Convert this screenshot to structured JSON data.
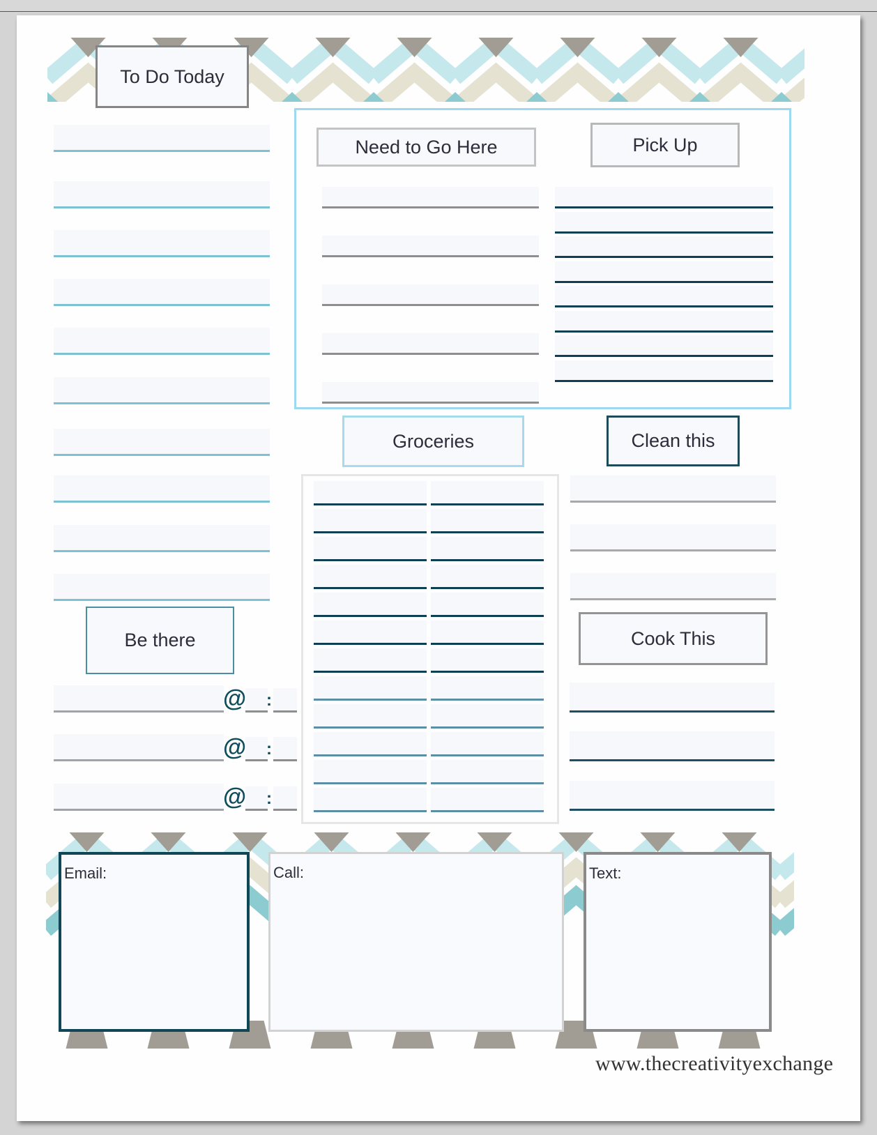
{
  "document": {
    "site_url": "www.thecreativityexchange"
  },
  "sections": {
    "to_do_today": {
      "title": "To Do Today",
      "line_count": 10
    },
    "need_to_go_here": {
      "title": "Need to Go Here",
      "line_count": 5
    },
    "pick_up": {
      "title": "Pick Up",
      "line_count": 8
    },
    "groceries": {
      "title": "Groceries",
      "line_count_per_column": 12,
      "columns": 2
    },
    "clean_this": {
      "title": "Clean this",
      "line_count": 3
    },
    "cook_this": {
      "title": "Cook This",
      "line_count": 3
    },
    "be_there": {
      "title": "Be there",
      "at_symbol": "@",
      "time_separator": ":",
      "line_count": 3
    }
  },
  "contact": {
    "email_label": "Email:",
    "call_label": "Call:",
    "text_label": "Text:"
  },
  "colors": {
    "teal_light": "#c5e8ec",
    "beige": "#e5e2d2",
    "taupe": "#a19d95",
    "teal_mid": "#8ccbd0",
    "sky_border": "#9dd9f1",
    "navy_line": "#0f3f52",
    "todo_line": "#7dc2d2",
    "gray_line": "#8e8e8e"
  }
}
